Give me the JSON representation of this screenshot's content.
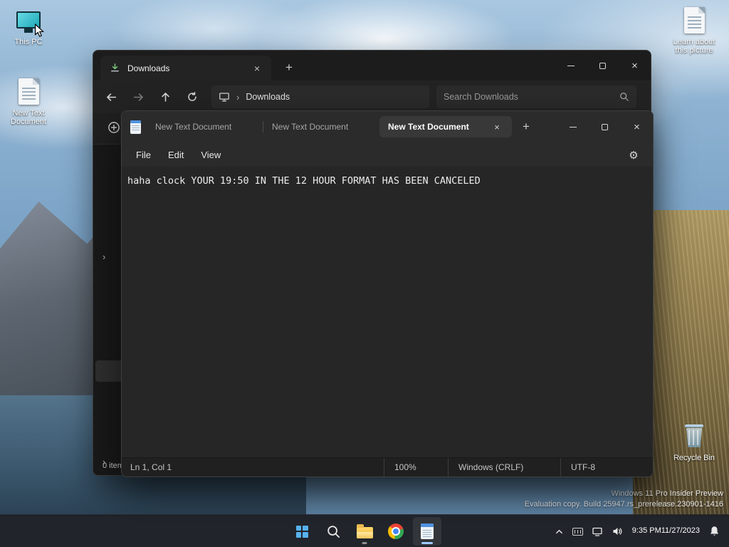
{
  "desktop": {
    "icons": {
      "this_pc": "This PC",
      "new_text_document": "New Text Document",
      "learn_about": "Learn about this picture",
      "recycle_bin": "Recycle Bin"
    },
    "watermark_line1": "Windows 11 Pro Insider Preview",
    "watermark_line2": "Evaluation copy. Build 25947.rs_prerelease.230901-1416"
  },
  "explorer": {
    "tab_title": "Downloads",
    "breadcrumb": "Downloads",
    "search_placeholder": "Search Downloads",
    "items_count": "0 items"
  },
  "notepad": {
    "tabs": [
      {
        "label": "New Text Document"
      },
      {
        "label": "New Text Document"
      },
      {
        "label": "New Text Document"
      }
    ],
    "menu": {
      "file": "File",
      "edit": "Edit",
      "view": "View"
    },
    "content": "haha clock YOUR 19:50 IN THE 12 HOUR FORMAT HAS BEEN CANCELED",
    "status": {
      "cursor_position": "Ln 1, Col 1",
      "zoom": "100%",
      "line_ending": "Windows (CRLF)",
      "encoding": "UTF-8"
    }
  },
  "taskbar": {
    "time": "9:35 PM",
    "date": "11/27/2023"
  }
}
